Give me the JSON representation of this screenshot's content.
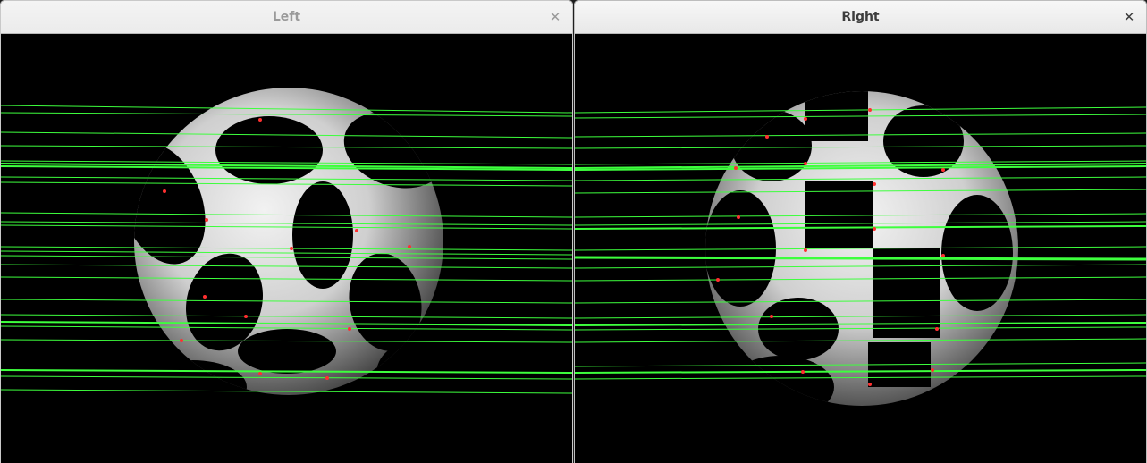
{
  "windows": [
    {
      "title": "Left",
      "close_icon": "close-icon",
      "state": "inactive"
    },
    {
      "title": "Right",
      "close_icon": "close-icon",
      "state": "active"
    }
  ],
  "close_glyph": "✕",
  "colors": {
    "background": "#000000",
    "epipolar_line": "#3dff3d",
    "match_point": "#ff3030",
    "sphere_light": "#f2f2f2",
    "sphere_dark": "#4a4a4a"
  }
}
